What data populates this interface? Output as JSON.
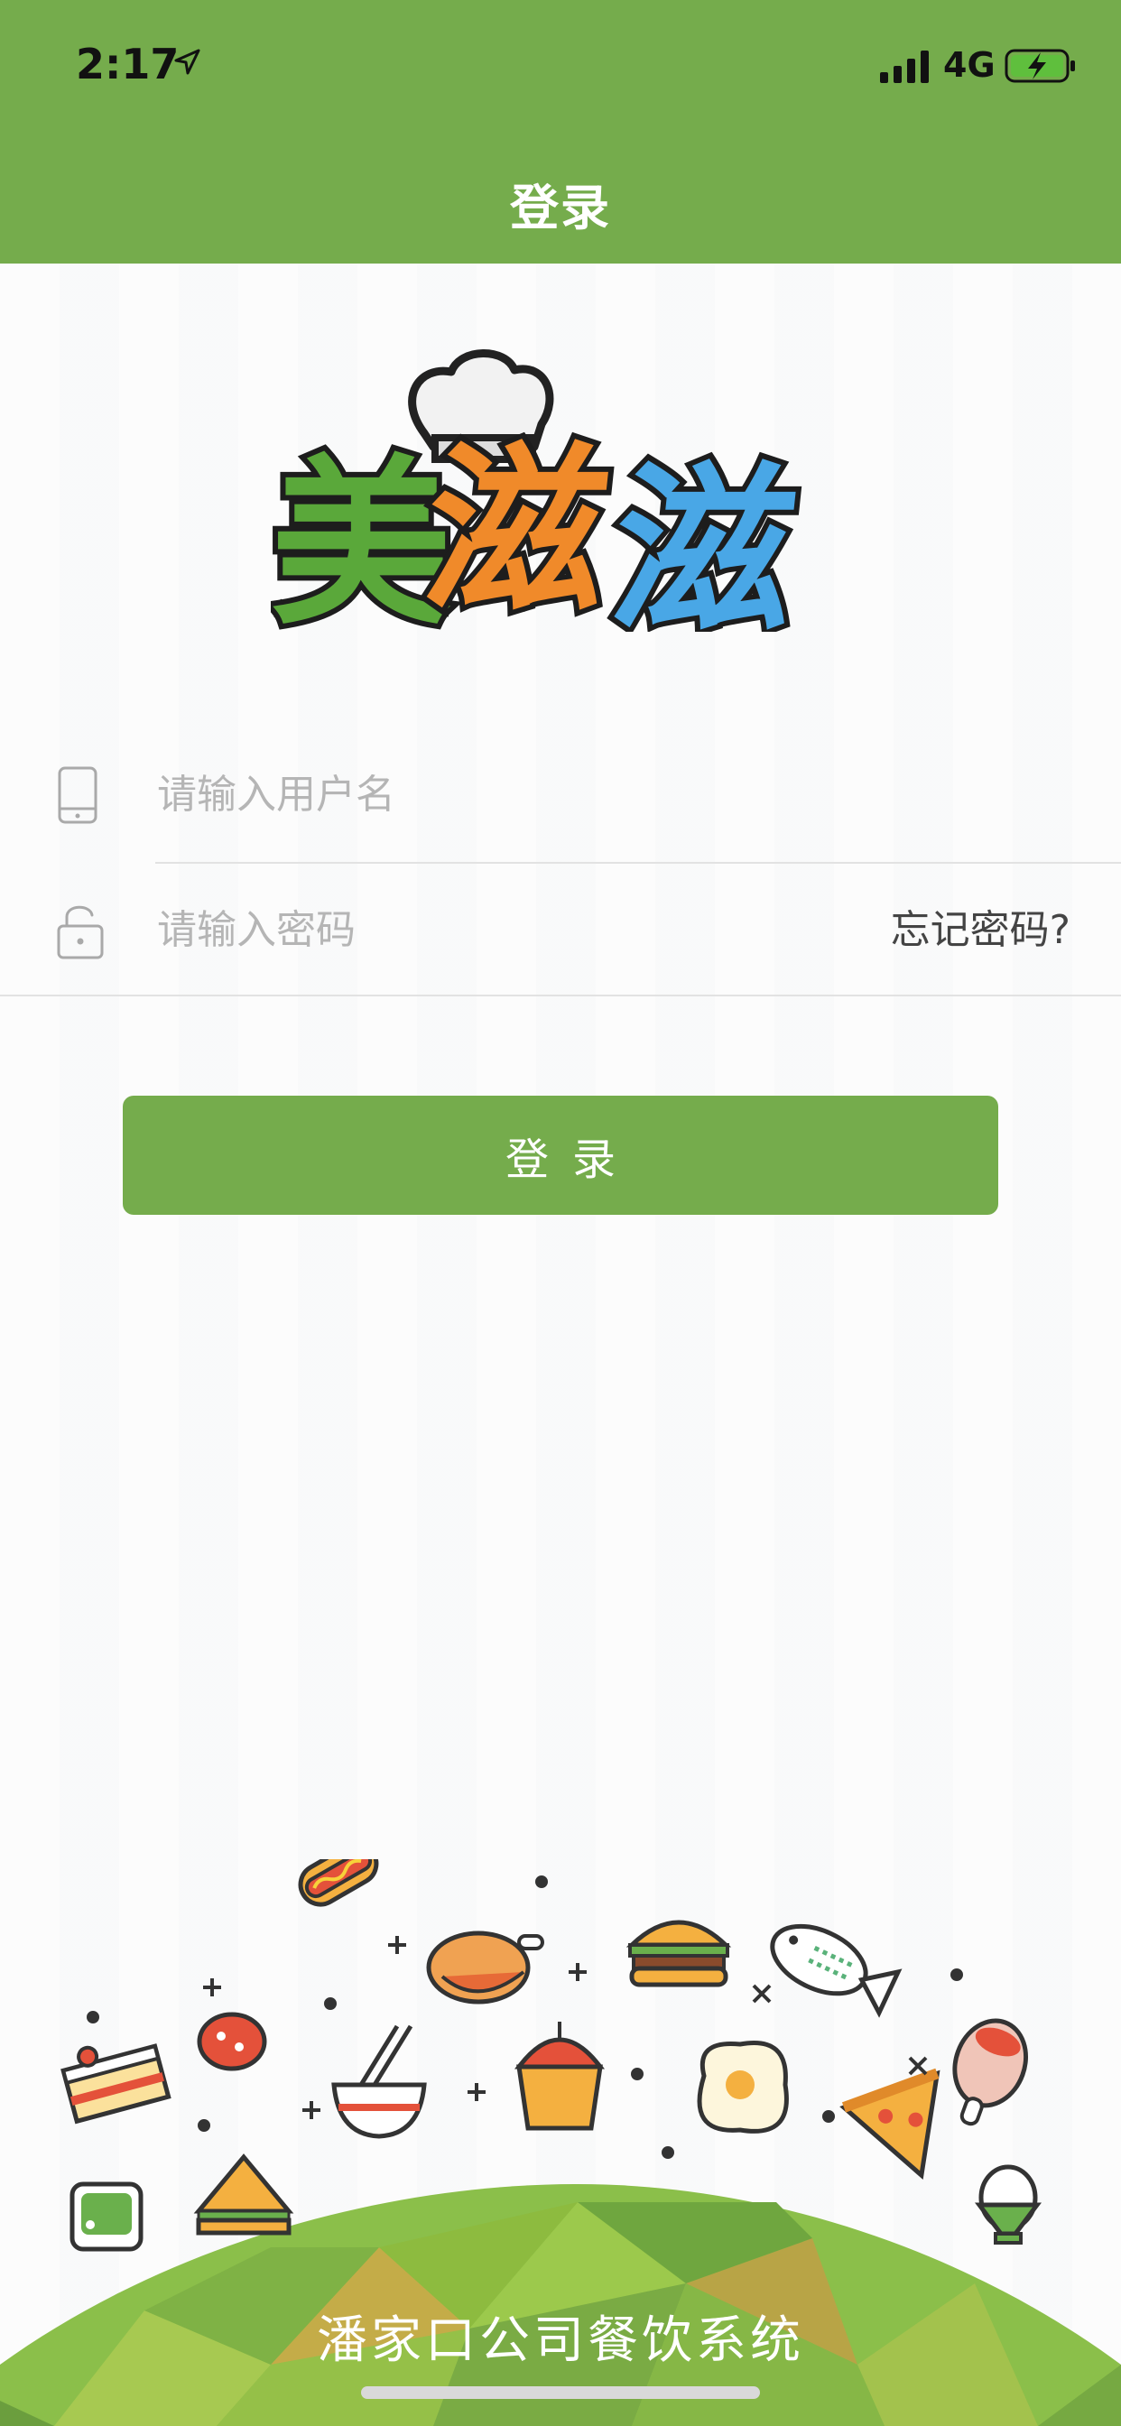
{
  "status_bar": {
    "time": "2:17",
    "network": "4G"
  },
  "header": {
    "title": "登录"
  },
  "logo": {
    "text": "美滋滋"
  },
  "form": {
    "username_placeholder": "请输入用户名",
    "password_placeholder": "请输入密码",
    "forgot_label": "忘记密码?",
    "login_label": "登录"
  },
  "footer": {
    "system_name": "潘家口公司餐饮系统"
  },
  "colors": {
    "primary_green": "#75ac4c",
    "logo_green": "#5aa83a",
    "logo_orange": "#f08a2a",
    "logo_blue": "#49a7e6"
  },
  "icons": {
    "phone": "phone-icon",
    "lock": "lock-icon",
    "location": "location-arrow-icon",
    "signal": "signal-bars-icon",
    "battery": "battery-charging-icon"
  }
}
